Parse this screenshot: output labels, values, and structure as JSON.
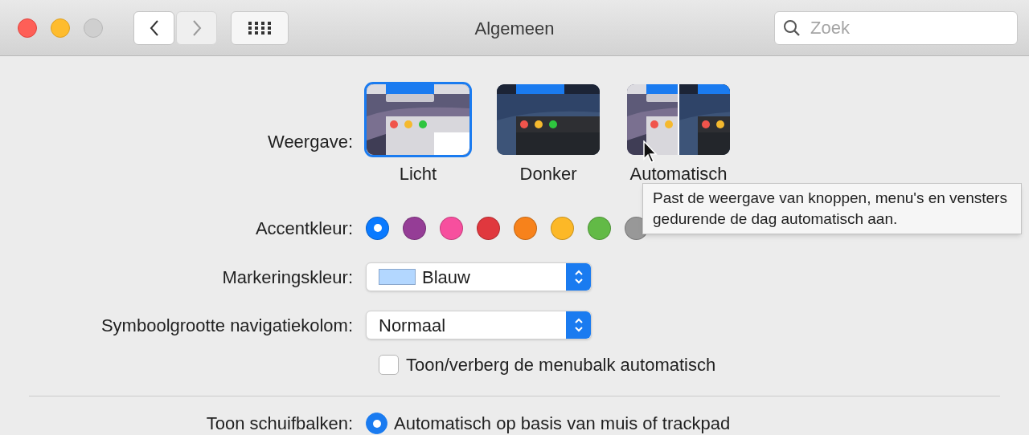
{
  "window": {
    "title": "Algemeen",
    "traffic_lights": [
      {
        "kind": "close",
        "disabled": false
      },
      {
        "kind": "minimize",
        "disabled": false
      },
      {
        "kind": "zoom",
        "disabled": true
      }
    ],
    "nav": [
      {
        "kind": "back",
        "disabled": false
      },
      {
        "kind": "forward",
        "disabled": true
      }
    ]
  },
  "search": {
    "placeholder": "Zoek"
  },
  "appearance": {
    "label": "Weergave:",
    "options": [
      {
        "kind": "light",
        "label": "Licht",
        "selected": true
      },
      {
        "kind": "dark",
        "label": "Donker",
        "selected": false
      },
      {
        "kind": "auto",
        "label": "Automatisch",
        "selected": false
      }
    ]
  },
  "tooltip": "Past de weergave van knoppen, menu's en vensters gedurende de dag automatisch aan.",
  "accent": {
    "label": "Accentkleur:",
    "colors": [
      {
        "color": "#0a7aff",
        "selected": true
      },
      {
        "color": "#953d96",
        "selected": false
      },
      {
        "color": "#f74f9e",
        "selected": false
      },
      {
        "color": "#e0383e",
        "selected": false
      },
      {
        "color": "#f7821b",
        "selected": false
      },
      {
        "color": "#fcb827",
        "selected": false
      },
      {
        "color": "#62ba46",
        "selected": false
      },
      {
        "color": "#989898",
        "selected": false
      }
    ]
  },
  "highlight": {
    "label": "Markeringskleur:",
    "value": "Blauw",
    "color": "#b3d7ff"
  },
  "sidebar_icon_size": {
    "label": "Symboolgrootte navigatiekolom:",
    "value": "Normaal"
  },
  "menubar": {
    "label": "Toon/verberg de menubalk automatisch",
    "checked": false
  },
  "scrollbars": {
    "label": "Toon schuifbalken:",
    "options": [
      {
        "label": "Automatisch op basis van muis of trackpad",
        "selected": true
      }
    ]
  }
}
